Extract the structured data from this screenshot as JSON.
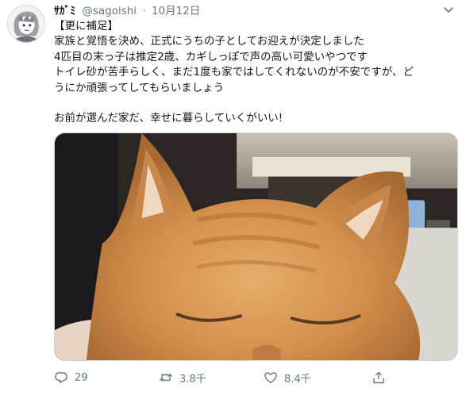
{
  "tweet": {
    "display_name": "ｻｶﾞﾐ",
    "handle": "@sagoishi",
    "separator": "·",
    "date": "10月12日",
    "lines": [
      "【更に補足】",
      "家族と覚悟を決め、正式にうちの子としてお迎えが決定しました",
      "4匹目の末っ子は推定2歳、カギしっぽで声の高い可愛いやつです",
      "トイレ砂が苦手らしく、まだ1度も家ではしてくれないのが不安ですが、ど",
      "うにか頑張ってしてもらいましょう"
    ],
    "closing_line": "お前が選んだ家だ、幸せに暮らしていくがいい!",
    "media_icon": "photo-of-orange-cat",
    "actions": {
      "reply_count": "29",
      "retweet_count": "3.8千",
      "like_count": "8.4千"
    }
  },
  "colors": {
    "text": "#14171a",
    "secondary": "#657786",
    "cat_orange": "#d8964f"
  }
}
